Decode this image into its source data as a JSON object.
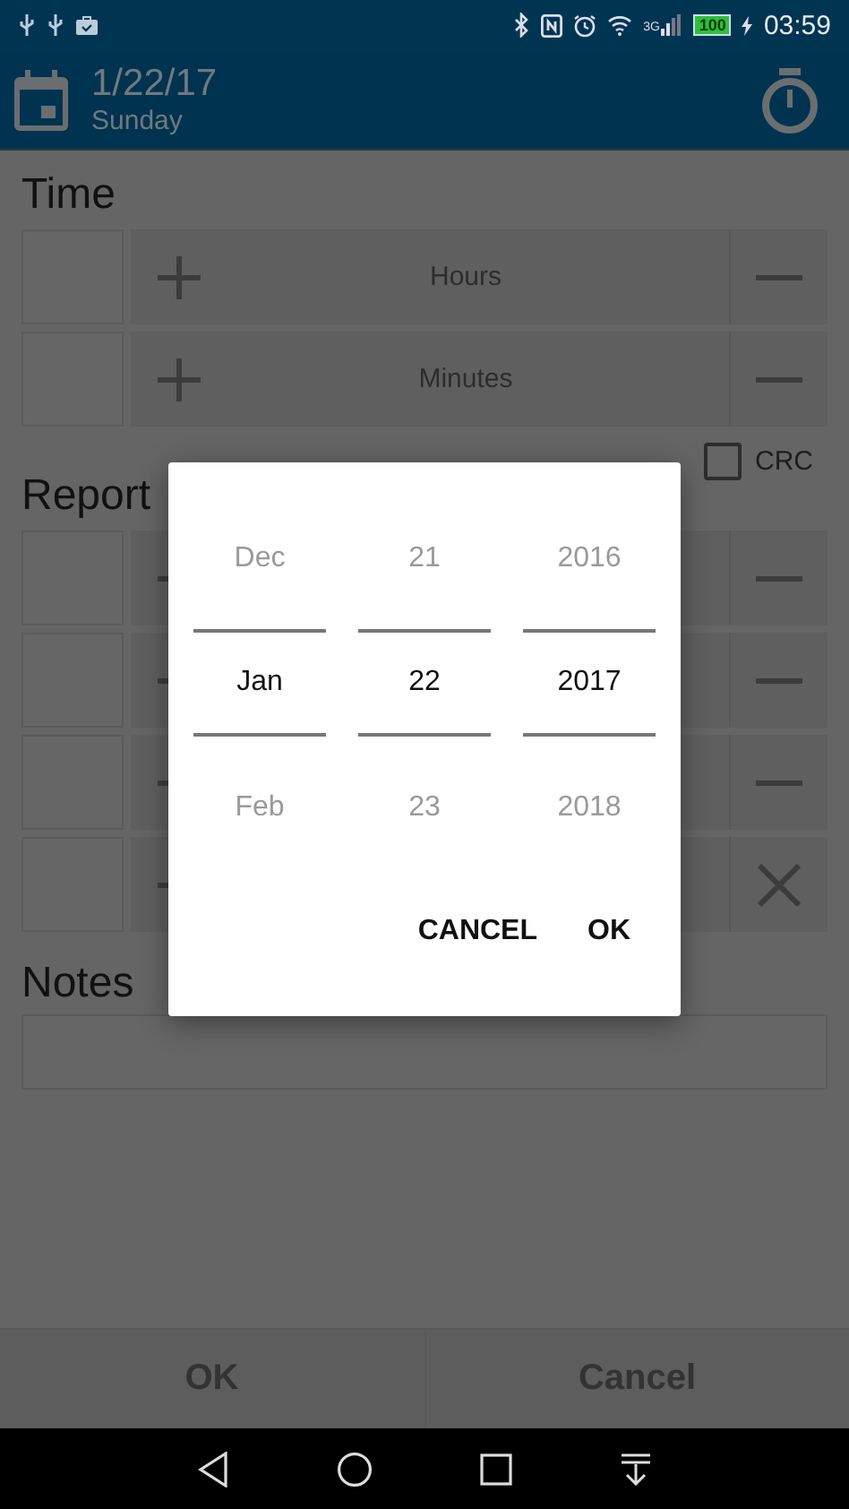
{
  "status_bar": {
    "battery": "100",
    "network": "3G",
    "time": "03:59"
  },
  "header": {
    "date": "1/22/17",
    "weekday": "Sunday"
  },
  "time": {
    "title": "Time",
    "rows": [
      {
        "label": "Hours"
      },
      {
        "label": "Minutes"
      }
    ]
  },
  "crc": {
    "label": "CRC",
    "checked": false
  },
  "report": {
    "title": "Report",
    "rows": [
      {
        "kind": "stepper"
      },
      {
        "kind": "stepper"
      },
      {
        "kind": "stepper"
      },
      {
        "kind": "removable"
      }
    ]
  },
  "notes": {
    "title": "Notes"
  },
  "date_picker": {
    "columns": [
      {
        "previous": "Dec",
        "current": "Jan",
        "next": "Feb"
      },
      {
        "previous": "21",
        "current": "22",
        "next": "23"
      },
      {
        "previous": "2016",
        "current": "2017",
        "next": "2018"
      }
    ],
    "buttons": [
      "CANCEL",
      "OK"
    ]
  },
  "footer": {
    "buttons": [
      "OK",
      "Cancel"
    ]
  }
}
